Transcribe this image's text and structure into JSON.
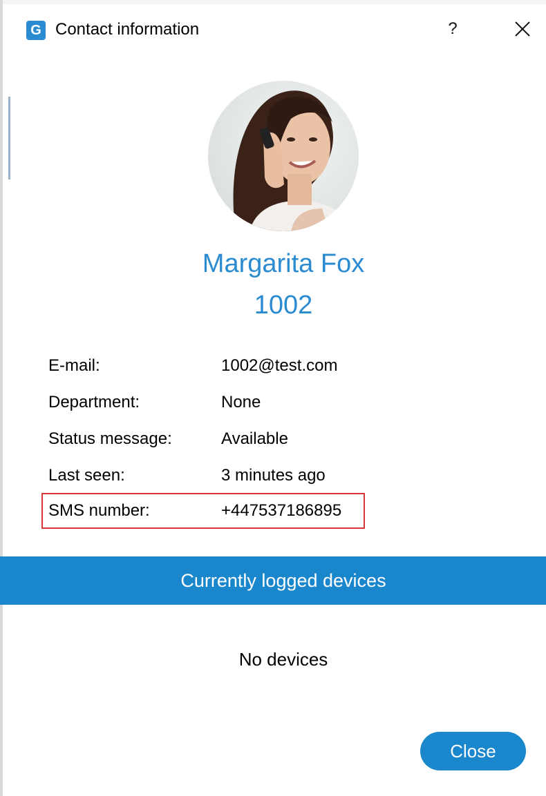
{
  "window": {
    "title": "Contact information",
    "help_label": "?",
    "logo_letter": "G"
  },
  "contact": {
    "name": "Margarita Fox",
    "extension": "1002",
    "fields": [
      {
        "label": "E-mail:",
        "value": "1002@test.com"
      },
      {
        "label": "Department:",
        "value": "None"
      },
      {
        "label": "Status message:",
        "value": "Available"
      },
      {
        "label": "Last seen:",
        "value": "3 minutes ago"
      },
      {
        "label": "SMS number:",
        "value": "+447537186895",
        "highlighted": true
      }
    ]
  },
  "devices": {
    "header": "Currently logged devices",
    "empty_text": "No devices"
  },
  "footer": {
    "close_label": "Close"
  },
  "colors": {
    "accent": "#1a87cc",
    "name_text": "#2a8bd0",
    "highlight_border": "#d6333b"
  },
  "icons": {
    "app": "app-logo-icon",
    "close": "close-icon",
    "avatar": "avatar-photo"
  }
}
